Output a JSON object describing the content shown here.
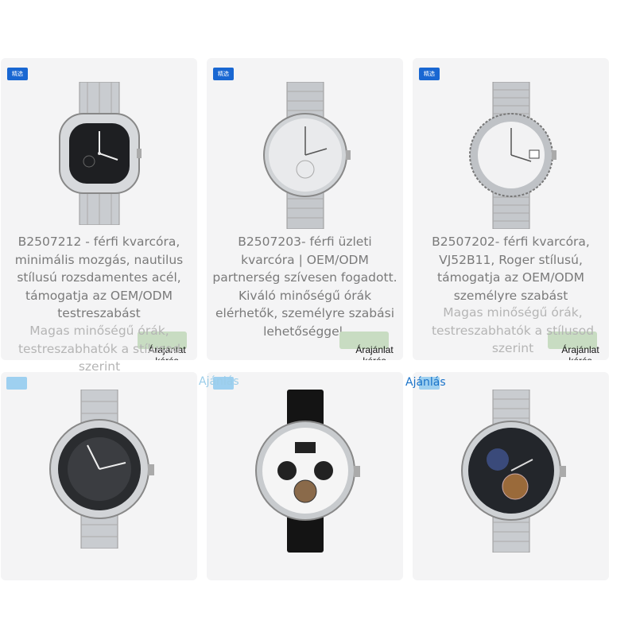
{
  "badges": {
    "label": "精选"
  },
  "products": [
    {
      "title": "B2507212 - férfi kvarcóra, minimális mozgás, nautilus stílusú rozsdamentes acél, támogatja az OEM/ODM testreszabást",
      "ghost": "Magas minőségű órák, testreszabhatók a stílusod szerint",
      "quote": "Árajánlat kérés"
    },
    {
      "title": "B2507203- férfi üzleti kvarcóra | OEM/ODM partnerség szívesen fogadott. Kiváló minőségű órák elérhetők, személyre szabási lehetőséggel.",
      "quote": "Árajánlat kérés"
    },
    {
      "title": "B2507202- férfi kvarcóra, VJ52B11, Roger stílusú, támogatja az OEM/ODM személyre szabást",
      "ghost": "Magas minőségű órák, testreszabhatók a stílusod szerint",
      "quote": "Árajánlat kérés"
    }
  ],
  "ajanlas": "Ajánlás",
  "accent": "#1967d2"
}
